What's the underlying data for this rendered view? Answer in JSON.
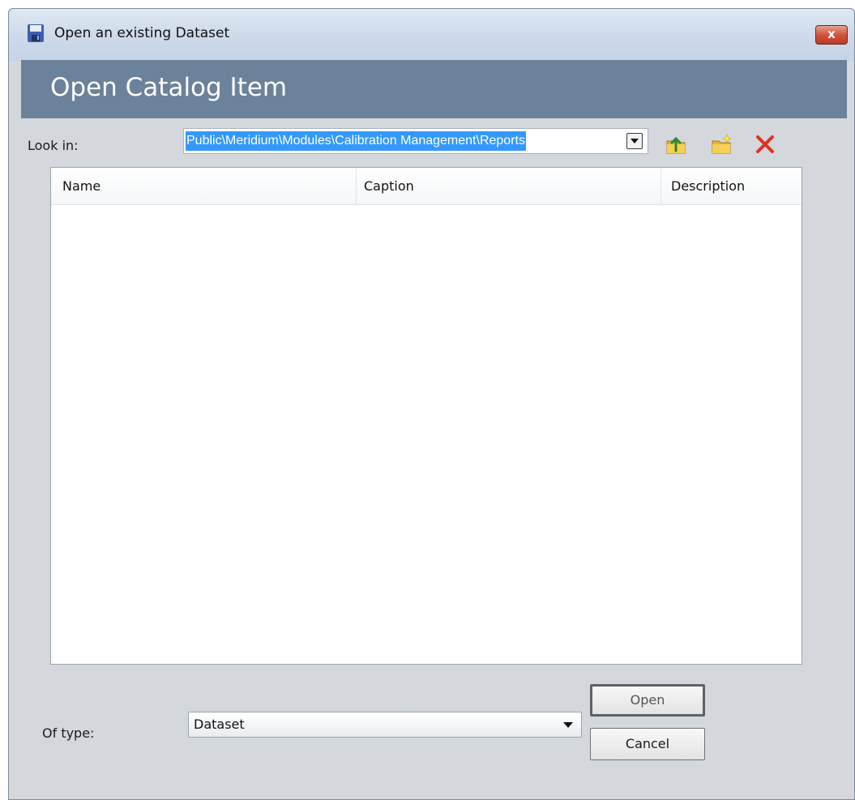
{
  "window": {
    "title": "Open an existing Dataset",
    "close_glyph": "x",
    "title_icon": "floppy-disk-icon"
  },
  "banner": {
    "title": "Open Catalog Item"
  },
  "look_in": {
    "label": "Look in:",
    "value": "Public\\Meridium\\Modules\\Calibration Management\\Reports"
  },
  "toolbar": {
    "up_icon": "up-folder-icon",
    "new_folder_icon": "new-folder-icon",
    "delete_icon": "delete-icon"
  },
  "list": {
    "columns": [
      "Name",
      "Caption",
      "Description"
    ],
    "rows": []
  },
  "of_type": {
    "label": "Of type:",
    "value": "Dataset"
  },
  "buttons": {
    "open": "Open",
    "cancel": "Cancel"
  },
  "colors": {
    "banner": "#6c819a",
    "selection": "#3399ff",
    "delete": "#e0301e"
  }
}
